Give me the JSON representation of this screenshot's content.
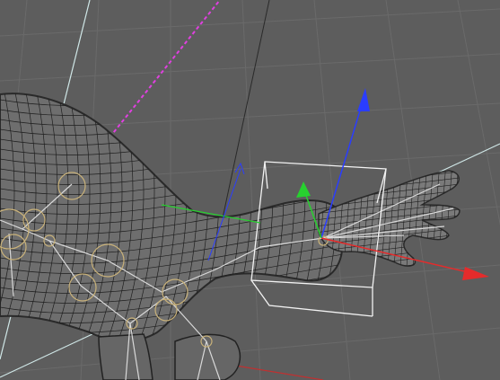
{
  "viewport": {
    "background": "#5d5d5d",
    "grid_color": "#6a6a6a"
  },
  "colors": {
    "mesh_fill": "#6e6e6e",
    "mesh_dark": "#3a3a3a",
    "wire": "#1f1f1f",
    "bone": "#d9d9d9",
    "joint": "#c9b27a",
    "bbox": "#f2f2f2",
    "axis_x": "#e52b2b",
    "axis_y": "#27d12f",
    "axis_z": "#2a3dff",
    "guide_magenta": "#e040e0",
    "guide_white": "#cfe6e6",
    "guide_dark": "#2a2a2a"
  },
  "objects": {
    "mesh_name": "arm-mesh",
    "gizmo": "move-gizmo",
    "selection": "bounding-box"
  }
}
